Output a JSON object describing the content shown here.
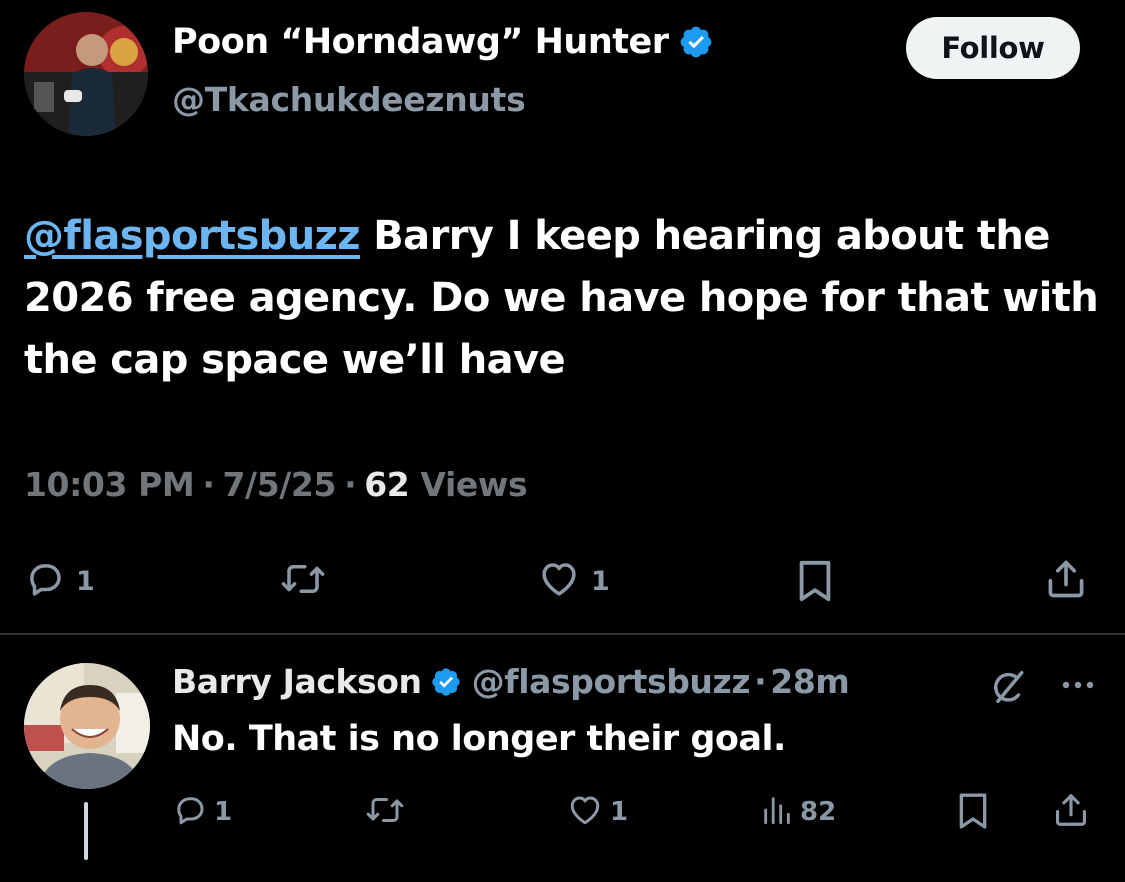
{
  "colors": {
    "background": "#000000",
    "text_primary": "#e7e9ea",
    "text_secondary": "#71767b",
    "link": "#6cb5f0",
    "verified": "#1d9bf0",
    "follow_bg": "#eff3f4",
    "divider": "#2f3336"
  },
  "tweet": {
    "author": {
      "display_name": "Poon “Horndawg” Hunter",
      "handle": "@Tkachukdeeznuts",
      "verified": true,
      "avatar_icon": "user-avatar-photo"
    },
    "follow_label": "Follow",
    "mention": "@flasportsbuzz",
    "body_text": " Barry I keep hearing about the 2026 free agency. Do we have hope for that with the cap space we’ll have",
    "time": "10:03 PM",
    "date": "7/5/25",
    "views_count": "62",
    "views_label": "Views",
    "actions": {
      "reply_icon": "reply-icon",
      "reply_count": "1",
      "retweet_icon": "retweet-icon",
      "like_icon": "heart-icon",
      "like_count": "1",
      "bookmark_icon": "bookmark-icon",
      "share_icon": "share-icon"
    }
  },
  "reply": {
    "author": {
      "display_name": "Barry Jackson",
      "handle": "@flasportsbuzz",
      "verified": true,
      "avatar_icon": "user-avatar-photo"
    },
    "separator": "·",
    "time_ago": "28m",
    "text": "No. That is no longer their goal.",
    "actions": {
      "reply_icon": "reply-icon",
      "reply_count": "1",
      "retweet_icon": "retweet-icon",
      "like_icon": "heart-icon",
      "like_count": "1",
      "views_icon": "analytics-icon",
      "views_count": "82",
      "bookmark_icon": "bookmark-icon",
      "share_icon": "share-icon",
      "grok_icon": "grok-icon",
      "more_icon": "more-icon"
    }
  }
}
